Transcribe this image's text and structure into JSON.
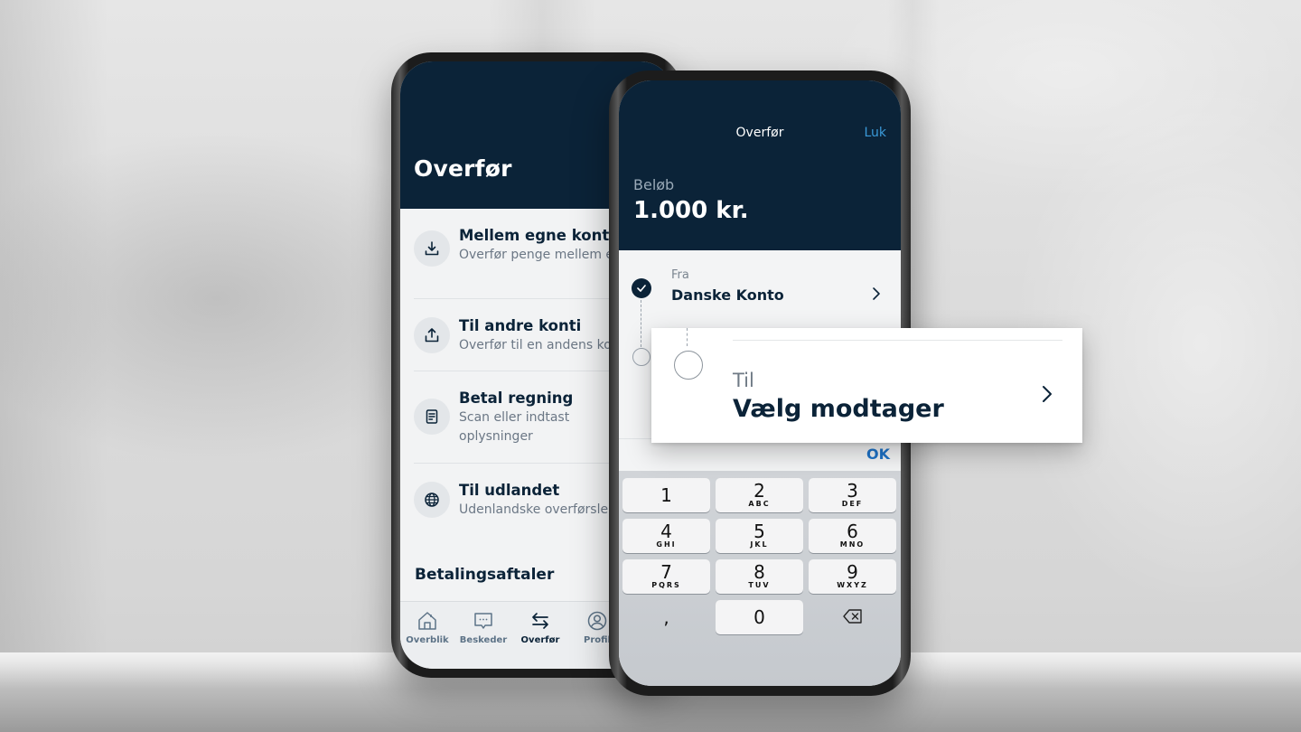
{
  "back_phone": {
    "title": "Overfør",
    "items": [
      {
        "icon": "download-icon",
        "title": "Mellem egne konti",
        "subtitle": "Overfør penge mellem egne konti"
      },
      {
        "icon": "upload-icon",
        "title": "Til andre konti",
        "subtitle": "Overfør til en andens konto"
      },
      {
        "icon": "bill-icon",
        "title": "Betal regning",
        "subtitle": "Scan eller indtast oplysninger"
      },
      {
        "icon": "globe-icon",
        "title": "Til udlandet",
        "subtitle": "Udenlandske overførsler"
      }
    ],
    "section_title": "Betalingsaftaler",
    "tabs": [
      {
        "icon": "home-icon",
        "label": "Overblik",
        "active": false
      },
      {
        "icon": "message-icon",
        "label": "Beskeder",
        "active": false
      },
      {
        "icon": "transfer-icon",
        "label": "Overfør",
        "active": true
      },
      {
        "icon": "profile-icon",
        "label": "Profil",
        "active": false
      }
    ]
  },
  "front_phone": {
    "nav_title": "Overfør",
    "close_label": "Luk",
    "amount_label": "Beløb",
    "amount_value": "1.000 kr.",
    "from": {
      "label": "Fra",
      "value": "Danske Konto"
    },
    "to": {
      "label": "Til",
      "value": "Vælg modtager"
    },
    "ok_label": "OK",
    "keypad": [
      {
        "num": "1",
        "letters": ""
      },
      {
        "num": "2",
        "letters": "ABC"
      },
      {
        "num": "3",
        "letters": "DEF"
      },
      {
        "num": "4",
        "letters": "GHI"
      },
      {
        "num": "5",
        "letters": "JKL"
      },
      {
        "num": "6",
        "letters": "MNO"
      },
      {
        "num": "7",
        "letters": "PQRS"
      },
      {
        "num": "8",
        "letters": "TUV"
      },
      {
        "num": "9",
        "letters": "WXYZ"
      },
      {
        "num": ",",
        "letters": ""
      },
      {
        "num": "0",
        "letters": ""
      },
      {
        "num": "",
        "letters": "",
        "icon": "backspace-icon"
      }
    ]
  },
  "colors": {
    "brand_navy": "#0b2338",
    "link_blue": "#3a9ad9",
    "ok_blue": "#1e73c8"
  }
}
